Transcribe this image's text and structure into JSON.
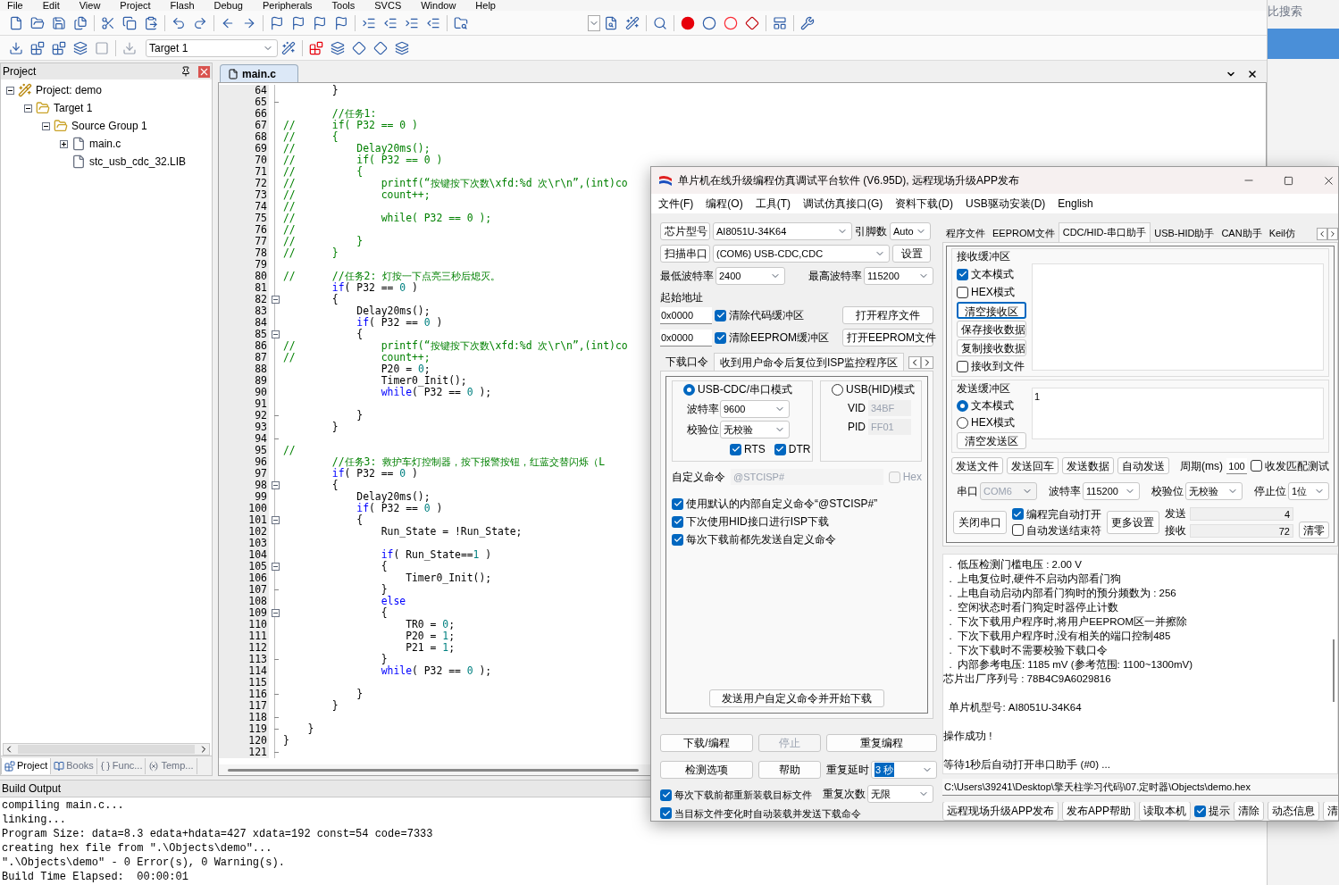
{
  "ide": {
    "menu": [
      "File",
      "Edit",
      "View",
      "Project",
      "Flash",
      "Debug",
      "Peripherals",
      "Tools",
      "SVCS",
      "Window",
      "Help"
    ],
    "target_select": {
      "value": "Target 1"
    },
    "project_panel": {
      "title": "Project",
      "tree": [
        {
          "label": "Project: demo",
          "kind": "project",
          "expanded": true,
          "children": [
            {
              "label": "Target 1",
              "kind": "target",
              "expanded": true,
              "children": [
                {
                  "label": "Source Group 1",
                  "kind": "folder",
                  "expanded": true,
                  "children": [
                    {
                      "label": "main.c",
                      "kind": "file",
                      "expanded": false
                    },
                    {
                      "label": "stc_usb_cdc_32.LIB",
                      "kind": "file"
                    }
                  ]
                }
              ]
            }
          ]
        }
      ],
      "tabs": [
        {
          "label": "Project",
          "kind": "project",
          "selected": true
        },
        {
          "label": "Books",
          "kind": "books",
          "selected": false
        },
        {
          "label": "Func...",
          "kind": "functions",
          "selected": false
        },
        {
          "label": "Temp...",
          "kind": "templates",
          "selected": false
        }
      ]
    },
    "editor": {
      "tabs": [
        {
          "label": "main.c",
          "selected": true
        }
      ],
      "lines": [
        {
          "number": "64",
          "kind": "plain",
          "tokens": [
            {
              "kind": "plain",
              "text": "        }"
            }
          ]
        },
        {
          "number": "65",
          "kind": "close"
        },
        {
          "number": "66",
          "kind": "plain",
          "tokens": [
            {
              "kind": "comment",
              "text": "        //任务1:"
            }
          ]
        },
        {
          "number": "67",
          "kind": "plain",
          "tokens": [
            {
              "kind": "comment",
              "text": "//      if( P32 == 0 )"
            }
          ]
        },
        {
          "number": "68",
          "kind": "plain",
          "tokens": [
            {
              "kind": "comment",
              "text": "//      {"
            }
          ]
        },
        {
          "number": "69",
          "kind": "plain",
          "tokens": [
            {
              "kind": "comment",
              "text": "//          Delay20ms();"
            }
          ]
        },
        {
          "number": "70",
          "kind": "plain",
          "tokens": [
            {
              "kind": "comment",
              "text": "//          if( P32 == 0 )"
            }
          ]
        },
        {
          "number": "71",
          "kind": "plain",
          "tokens": [
            {
              "kind": "comment",
              "text": "//          {"
            }
          ]
        },
        {
          "number": "72",
          "kind": "plain",
          "tokens": [
            {
              "kind": "comment",
              "text": "//              printf(“按键按下次数\\xfd:%d 次\\r\\n”,(int)co"
            }
          ]
        },
        {
          "number": "73",
          "kind": "plain",
          "tokens": [
            {
              "kind": "comment",
              "text": "//              count++;"
            }
          ]
        },
        {
          "number": "74",
          "kind": "plain",
          "tokens": [
            {
              "kind": "comment",
              "text": "//"
            }
          ]
        },
        {
          "number": "75",
          "kind": "plain",
          "tokens": [
            {
              "kind": "comment",
              "text": "//              while( P32 == 0 );"
            }
          ]
        },
        {
          "number": "76",
          "kind": "plain",
          "tokens": [
            {
              "kind": "comment",
              "text": "//"
            }
          ]
        },
        {
          "number": "77",
          "kind": "plain",
          "tokens": [
            {
              "kind": "comment",
              "text": "//          }"
            }
          ]
        },
        {
          "number": "78",
          "kind": "plain",
          "tokens": [
            {
              "kind": "comment",
              "text": "//      }"
            }
          ]
        },
        {
          "number": "79",
          "kind": "plain"
        },
        {
          "number": "80",
          "kind": "plain",
          "tokens": [
            {
              "kind": "comment",
              "text": "//      //任务2: 灯按一下点亮三秒后熄灭。"
            }
          ]
        },
        {
          "number": "81",
          "kind": "plain",
          "tokens": [
            {
              "kind": "keyword",
              "text": "        if"
            },
            {
              "kind": "plain",
              "text": "( P32 == "
            },
            {
              "kind": "number",
              "text": "0"
            },
            {
              "kind": "plain",
              "text": " )"
            }
          ]
        },
        {
          "number": "82",
          "kind": "open",
          "tokens": [
            {
              "kind": "plain",
              "text": "        {"
            }
          ]
        },
        {
          "number": "83",
          "kind": "plain",
          "tokens": [
            {
              "kind": "plain",
              "text": "            Delay20ms();"
            }
          ]
        },
        {
          "number": "84",
          "kind": "plain",
          "tokens": [
            {
              "kind": "keyword",
              "text": "            if"
            },
            {
              "kind": "plain",
              "text": "( P32 == "
            },
            {
              "kind": "number",
              "text": "0"
            },
            {
              "kind": "plain",
              "text": " )"
            }
          ]
        },
        {
          "number": "85",
          "kind": "open",
          "tokens": [
            {
              "kind": "plain",
              "text": "            {"
            }
          ]
        },
        {
          "number": "86",
          "kind": "plain",
          "tokens": [
            {
              "kind": "comment",
              "text": "//              printf(“按键按下次数\\xfd:%d 次\\r\\n”,(int)co"
            }
          ]
        },
        {
          "number": "87",
          "kind": "plain",
          "tokens": [
            {
              "kind": "comment",
              "text": "//              count++;"
            }
          ]
        },
        {
          "number": "88",
          "kind": "plain",
          "tokens": [
            {
              "kind": "plain",
              "text": "                P20 = "
            },
            {
              "kind": "number",
              "text": "0"
            },
            {
              "kind": "plain",
              "text": ";"
            }
          ]
        },
        {
          "number": "89",
          "kind": "plain",
          "tokens": [
            {
              "kind": "plain",
              "text": "                Timer0_Init();"
            }
          ]
        },
        {
          "number": "90",
          "kind": "plain",
          "tokens": [
            {
              "kind": "keyword",
              "text": "                while"
            },
            {
              "kind": "plain",
              "text": "( P32 == "
            },
            {
              "kind": "number",
              "text": "0"
            },
            {
              "kind": "plain",
              "text": " );"
            }
          ]
        },
        {
          "number": "91",
          "kind": "plain"
        },
        {
          "number": "92",
          "kind": "close",
          "tokens": [
            {
              "kind": "plain",
              "text": "            }"
            }
          ]
        },
        {
          "number": "93",
          "kind": "plain",
          "tokens": [
            {
              "kind": "plain",
              "text": "        }"
            }
          ]
        },
        {
          "number": "94",
          "kind": "close"
        },
        {
          "number": "95",
          "kind": "plain",
          "tokens": [
            {
              "kind": "comment",
              "text": "//"
            }
          ]
        },
        {
          "number": "96",
          "kind": "plain",
          "tokens": [
            {
              "kind": "comment",
              "text": "        //任务3: 救护车灯控制器，按下报警按钮，红蓝交替闪烁（L"
            }
          ]
        },
        {
          "number": "97",
          "kind": "plain",
          "tokens": [
            {
              "kind": "keyword",
              "text": "        if"
            },
            {
              "kind": "plain",
              "text": "( P32 == "
            },
            {
              "kind": "number",
              "text": "0"
            },
            {
              "kind": "plain",
              "text": " )"
            }
          ]
        },
        {
          "number": "98",
          "kind": "open",
          "tokens": [
            {
              "kind": "plain",
              "text": "        {"
            }
          ]
        },
        {
          "number": "99",
          "kind": "plain",
          "tokens": [
            {
              "kind": "plain",
              "text": "            Delay20ms();"
            }
          ]
        },
        {
          "number": "100",
          "kind": "plain",
          "tokens": [
            {
              "kind": "keyword",
              "text": "            if"
            },
            {
              "kind": "plain",
              "text": "( P32 == "
            },
            {
              "kind": "number",
              "text": "0"
            },
            {
              "kind": "plain",
              "text": " )"
            }
          ]
        },
        {
          "number": "101",
          "kind": "open",
          "tokens": [
            {
              "kind": "plain",
              "text": "            {"
            }
          ]
        },
        {
          "number": "102",
          "kind": "plain",
          "tokens": [
            {
              "kind": "plain",
              "text": "                Run_State = !Run_State;"
            }
          ]
        },
        {
          "number": "103",
          "kind": "plain"
        },
        {
          "number": "104",
          "kind": "plain",
          "tokens": [
            {
              "kind": "keyword",
              "text": "                if"
            },
            {
              "kind": "plain",
              "text": "( Run_State=="
            },
            {
              "kind": "number",
              "text": "1"
            },
            {
              "kind": "plain",
              "text": " )"
            }
          ]
        },
        {
          "number": "105",
          "kind": "open",
          "tokens": [
            {
              "kind": "plain",
              "text": "                {"
            }
          ]
        },
        {
          "number": "106",
          "kind": "plain",
          "tokens": [
            {
              "kind": "plain",
              "text": "                    Timer0_Init();"
            }
          ]
        },
        {
          "number": "107",
          "kind": "close",
          "tokens": [
            {
              "kind": "plain",
              "text": "                }"
            }
          ]
        },
        {
          "number": "108",
          "kind": "plain",
          "tokens": [
            {
              "kind": "keyword",
              "text": "                else"
            }
          ]
        },
        {
          "number": "109",
          "kind": "open",
          "tokens": [
            {
              "kind": "plain",
              "text": "                {"
            }
          ]
        },
        {
          "number": "110",
          "kind": "plain",
          "tokens": [
            {
              "kind": "plain",
              "text": "                    TR0 = "
            },
            {
              "kind": "number",
              "text": "0"
            },
            {
              "kind": "plain",
              "text": ";"
            }
          ]
        },
        {
          "number": "111",
          "kind": "plain",
          "tokens": [
            {
              "kind": "plain",
              "text": "                    P20 = "
            },
            {
              "kind": "number",
              "text": "1"
            },
            {
              "kind": "plain",
              "text": ";"
            }
          ]
        },
        {
          "number": "112",
          "kind": "plain",
          "tokens": [
            {
              "kind": "plain",
              "text": "                    P21 = "
            },
            {
              "kind": "number",
              "text": "1"
            },
            {
              "kind": "plain",
              "text": ";"
            }
          ]
        },
        {
          "number": "113",
          "kind": "close",
          "tokens": [
            {
              "kind": "plain",
              "text": "                }"
            }
          ]
        },
        {
          "number": "114",
          "kind": "plain",
          "tokens": [
            {
              "kind": "keyword",
              "text": "                while"
            },
            {
              "kind": "plain",
              "text": "( P32 == "
            },
            {
              "kind": "number",
              "text": "0"
            },
            {
              "kind": "plain",
              "text": " );"
            }
          ]
        },
        {
          "number": "115",
          "kind": "plain"
        },
        {
          "number": "116",
          "kind": "close",
          "tokens": [
            {
              "kind": "plain",
              "text": "            }"
            }
          ]
        },
        {
          "number": "117",
          "kind": "plain",
          "tokens": [
            {
              "kind": "plain",
              "text": "        }"
            }
          ]
        },
        {
          "number": "118",
          "kind": "close"
        },
        {
          "number": "119",
          "kind": "close",
          "tokens": [
            {
              "kind": "plain",
              "text": "    }"
            }
          ]
        },
        {
          "number": "120",
          "kind": "plain",
          "tokens": [
            {
              "kind": "plain",
              "text": "}"
            }
          ]
        },
        {
          "number": "121",
          "kind": "close"
        }
      ]
    },
    "build_output": {
      "title": "Build Output",
      "lines": [
        "compiling main.c...",
        "linking...",
        "Program Size: data=8.3 edata+hdata=427 xdata=192 const=54 code=7333",
        "creating hex file from \".\\Objects\\demo\"...",
        "\".\\Objects\\demo\" - 0 Error(s), 0 Warning(s).",
        "Build Time Elapsed:  00:00:01"
      ]
    }
  },
  "side_window": {
    "search_text": "比搜索"
  },
  "dialog": {
    "title": "单片机在线升级编程仿真调试平台软件 (V6.95D), 远程现场升级APP发布",
    "menu": [
      "文件(F)",
      "编程(O)",
      "工具(T)",
      "调试仿真接口(G)",
      "资料下载(D)",
      "USB驱动安装(D)",
      "English"
    ],
    "chip": {
      "button": "芯片型号",
      "value": "AI8051U-34K64",
      "pins_label": "引脚数",
      "pins_value": "Auto"
    },
    "port": {
      "button": "扫描串口",
      "value": "(COM6) USB-CDC,CDC",
      "settings_button": "设置"
    },
    "baud": {
      "min_label": "最低波特率",
      "min_value": "2400",
      "max_label": "最高波特率",
      "max_value": "115200"
    },
    "start_address": {
      "label": "起始地址",
      "rows": [
        {
          "address": "0x0000",
          "checkbox": "清除代码缓冲区",
          "checked": true,
          "button": "打开程序文件"
        },
        {
          "address": "0x0000",
          "checkbox": "清除EEPROM缓冲区",
          "checked": true,
          "button": "打开EEPROM文件"
        }
      ]
    },
    "options_tabs": [
      {
        "label": "下载口令",
        "selected": false
      },
      {
        "label": "收到用户命令后复位到ISP监控程序区",
        "selected": true
      }
    ],
    "reset_panel": {
      "modes": [
        {
          "label": "USB-CDC/串口模式",
          "selected": true,
          "fields": [
            {
              "label": "波特率",
              "value": "9600",
              "kind": "select"
            },
            {
              "label": "校验位",
              "value": "无校验",
              "kind": "select"
            }
          ],
          "checkboxes": [
            {
              "label": "RTS",
              "checked": true
            },
            {
              "label": "DTR",
              "checked": true
            }
          ]
        },
        {
          "label": "USB(HID)模式",
          "selected": false,
          "fields": [
            {
              "label": "VID",
              "value": "34BF",
              "kind": "text"
            },
            {
              "label": "PID",
              "value": "FF01",
              "kind": "text"
            }
          ]
        }
      ],
      "custom_command": {
        "label": "自定义命令",
        "value": "@STCISP#",
        "hex_label": "Hex",
        "hex_checked": false
      },
      "options": [
        {
          "label": "使用默认的内部自定义命令“@STCISP#”",
          "checked": true
        },
        {
          "label": "下次使用HID接口进行ISP下载",
          "checked": true
        },
        {
          "label": "每次下载前都先发送自定义命令",
          "checked": true
        }
      ],
      "send_button": "发送用户自定义命令并开始下载"
    },
    "actions": [
      {
        "label": "下载/编程",
        "disabled": false
      },
      {
        "label": "停止",
        "disabled": true
      },
      {
        "label": "重复编程",
        "disabled": false
      },
      {
        "label": "检测选项",
        "disabled": false
      },
      {
        "label": "帮助",
        "disabled": false
      }
    ],
    "repeat": [
      {
        "label": "重复延时",
        "value": "3 秒",
        "highlighted": true
      },
      {
        "label": "重复次数",
        "value": "无限",
        "highlighted": false
      }
    ],
    "reload_options": [
      {
        "label": "每次下载前都重新装载目标文件",
        "checked": true
      },
      {
        "label": "当目标文件变化时自动装载并发送下载命令",
        "checked": true
      }
    ],
    "tool_tabs": [
      {
        "label": "程序文件",
        "selected": false
      },
      {
        "label": "EEPROM文件",
        "selected": false
      },
      {
        "label": "CDC/HID-串口助手",
        "selected": true
      },
      {
        "label": "USB-HID助手",
        "selected": false
      },
      {
        "label": "CAN助手",
        "selected": false
      },
      {
        "label": "Keil仿",
        "selected": false
      }
    ],
    "serial": {
      "receive": {
        "title": "接收缓冲区",
        "modes": [
          {
            "label": "文本模式",
            "checked": true
          },
          {
            "label": "HEX模式",
            "checked": false
          }
        ],
        "buttons": [
          {
            "label": "清空接收区",
            "focused": true
          },
          {
            "label": "保存接收数据",
            "focused": false
          },
          {
            "label": "复制接收数据",
            "focused": false
          }
        ],
        "to_file": {
          "label": "接收到文件",
          "checked": false
        }
      },
      "send": {
        "title": "发送缓冲区",
        "modes": [
          {
            "label": "文本模式",
            "selected": true
          },
          {
            "label": "HEX模式",
            "selected": false
          }
        ],
        "clear_button": "清空发送区",
        "text": "1"
      },
      "send_buttons": [
        "发送文件",
        "发送回车",
        "发送数据",
        "自动发送"
      ],
      "period": {
        "label": "周期(ms)",
        "value": "100"
      },
      "match_test": {
        "label": "收发匹配测试",
        "checked": false
      },
      "settings": [
        {
          "label": "串口",
          "value": "COM6",
          "disabled": true
        },
        {
          "label": "波特率",
          "value": "115200",
          "disabled": false
        },
        {
          "label": "校验位",
          "value": "无校验",
          "disabled": false
        },
        {
          "label": "停止位",
          "value": "1位",
          "disabled": false
        }
      ],
      "close_button": "关闭串口",
      "auto_options": [
        {
          "label": "编程完自动打开",
          "checked": true
        },
        {
          "label": "自动发送结束符",
          "checked": false
        }
      ],
      "more_button": "更多设置",
      "counters": [
        {
          "label": "发送",
          "value": "4"
        },
        {
          "label": "接收",
          "value": "72"
        }
      ],
      "clear_button": "清零"
    },
    "log": [
      {
        "lines": [
          "  .  低压检测门槛电压 : 2.00 V",
          "  .  上电复位时,硬件不启动内部看门狗",
          "  .  上电自动启动内部看门狗时的预分频数为 : 256",
          "  .  空闲状态时看门狗定时器停止计数",
          "  .  下次下载用户程序时,将用户EEPROM区一并擦除",
          "  .  下次下载用户程序时,没有相关的端口控制485",
          "  .  下次下载时不需要校验下载口令",
          "  .  内部参考电压: 1185 mV (参考范围: 1100~1300mV)",
          "芯片出厂序列号 : 78B4C9A6029816"
        ]
      },
      {
        "lines": [
          "  单片机型号: AI8051U-34K64"
        ]
      },
      {
        "lines": [
          "操作成功 !"
        ]
      },
      {
        "lines": [
          "等待1秒后自动打开串口助手 (#0) ..."
        ]
      }
    ],
    "file_path": "C:\\Users\\39241\\Desktop\\擎天柱学习代码\\07.定时器\\Objects\\demo.hex",
    "bottom_bar": [
      {
        "kind": "button",
        "label": "远程现场升级APP发布"
      },
      {
        "kind": "button",
        "label": "发布APP帮助"
      },
      {
        "kind": "button",
        "label": "读取本机"
      },
      {
        "kind": "checkbox",
        "label": "提示",
        "checked": true
      },
      {
        "kind": "button",
        "label": "清除"
      },
      {
        "kind": "button",
        "label": "动态信息"
      },
      {
        "kind": "button",
        "label": "清"
      }
    ]
  }
}
